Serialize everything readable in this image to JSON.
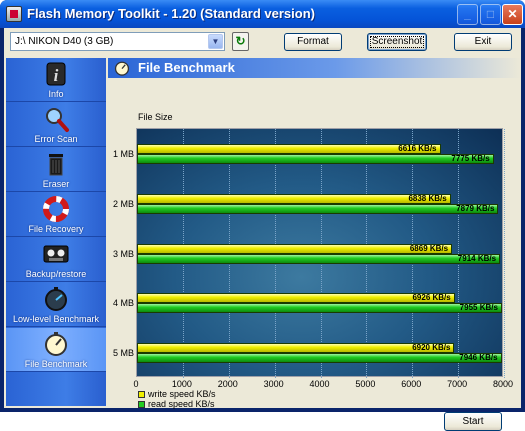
{
  "window": {
    "title": "Flash Memory Toolkit - 1.20 (Standard version)"
  },
  "titlebar_buttons": {
    "minimize": "_",
    "maximize": "□",
    "close": "✕"
  },
  "toolbar": {
    "drive_value": "J:\\ NIKON   D40 (3 GB)",
    "format_label": "Format",
    "screenshot_label": "Screenshot",
    "exit_label": "Exit"
  },
  "sidebar": {
    "items": [
      {
        "label": "Info",
        "icon": "info-icon"
      },
      {
        "label": "Error Scan",
        "icon": "magnifier-icon"
      },
      {
        "label": "Eraser",
        "icon": "trash-icon"
      },
      {
        "label": "File Recovery",
        "icon": "lifebuoy-icon"
      },
      {
        "label": "Backup/restore",
        "icon": "tape-icon"
      },
      {
        "label": "Low-level Benchmark",
        "icon": "stopwatch-icon"
      },
      {
        "label": "File Benchmark",
        "icon": "stopwatch-icon",
        "active": true
      }
    ]
  },
  "panel": {
    "title": "File Benchmark"
  },
  "start_label": "Start",
  "colors": {
    "write": "#f0f000",
    "read": "#22cc22",
    "accent": "#2a63d4"
  },
  "chart_data": {
    "type": "bar",
    "orientation": "horizontal",
    "ylabel": "File Size",
    "categories": [
      "1 MB",
      "2 MB",
      "3 MB",
      "4 MB",
      "5 MB"
    ],
    "series": [
      {
        "name": "write speed KB/s",
        "values": [
          6616,
          6838,
          6869,
          6926,
          6920
        ],
        "labels": [
          "6616 KB/s",
          "6838 KB/s",
          "6869 KB/s",
          "6926 KB/s",
          "6920 KB/s"
        ]
      },
      {
        "name": "read speed KB/s",
        "values": [
          7775,
          7879,
          7914,
          7955,
          7946
        ],
        "labels": [
          "7775 KB/s",
          "7879 KB/s",
          "7914 KB/s",
          "7955 KB/s",
          "7946 KB/s"
        ]
      }
    ],
    "xlim": [
      0,
      8000
    ],
    "xticks": [
      "0",
      "1000",
      "2000",
      "3000",
      "4000",
      "5000",
      "6000",
      "7000",
      "8000"
    ],
    "grid": true,
    "legend": "bottom-left"
  }
}
